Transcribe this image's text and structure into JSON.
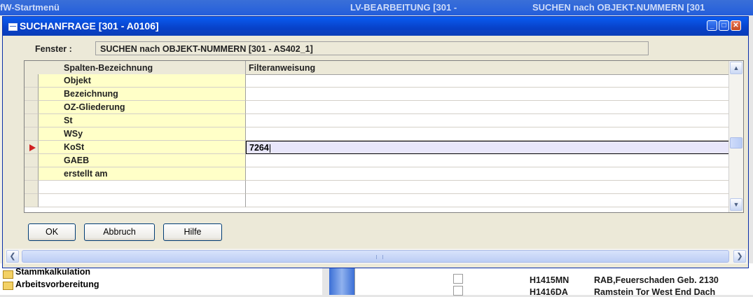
{
  "background": {
    "taskbar_titles": [
      "fW-Startmenü",
      "LV-BEARBEITUNG  [301 -",
      "SUCHEN nach OBJEKT-NUMMERN  [301"
    ],
    "tree_items": [
      "Stammkalkulation",
      "Arbeitsvorbereitung"
    ],
    "table_rows": [
      {
        "code": "H1415MN",
        "text": "RAB,Feuerschaden Geb. 2130"
      },
      {
        "code": "H1416DA",
        "text": "Ramstein Tor West End Dach"
      }
    ]
  },
  "dialog": {
    "title": "SUCHANFRAGE  [301 - A0106]",
    "fenster_label": "Fenster   :",
    "fenster_value": "SUCHEN nach OBJEKT-NUMMERN  [301 - AS402_1]",
    "columns": {
      "name": "Spalten-Bezeichnung",
      "filter": "Filteranweisung"
    },
    "rows": [
      {
        "name": "Objekt",
        "filter": ""
      },
      {
        "name": "Bezeichnung",
        "filter": ""
      },
      {
        "name": "OZ-Gliederung",
        "filter": ""
      },
      {
        "name": "St",
        "filter": ""
      },
      {
        "name": "WSy",
        "filter": ""
      },
      {
        "name": "KoSt",
        "filter": "7264"
      },
      {
        "name": "GAEB",
        "filter": ""
      },
      {
        "name": "erstellt am",
        "filter": ""
      },
      {
        "name": "",
        "filter": ""
      },
      {
        "name": "",
        "filter": ""
      }
    ],
    "active_row": "KoSt",
    "buttons": {
      "ok": "OK",
      "cancel": "Abbruch",
      "help": "Hilfe"
    }
  }
}
